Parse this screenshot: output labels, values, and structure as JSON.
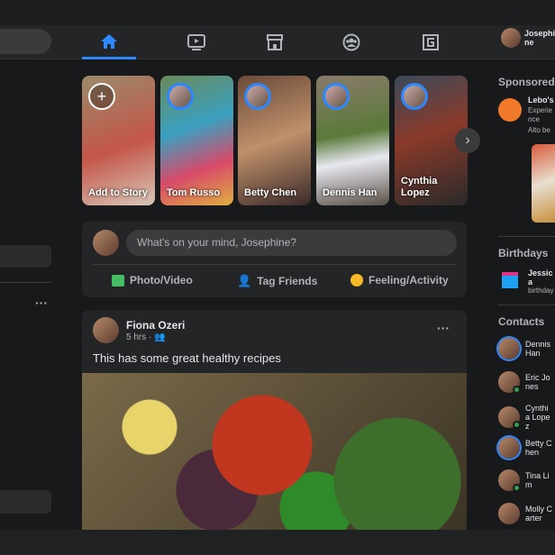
{
  "header": {
    "user_name": "Josephine",
    "nav": [
      {
        "icon": "home-icon",
        "active": true
      },
      {
        "icon": "watch-icon"
      },
      {
        "icon": "marketplace-icon"
      },
      {
        "icon": "groups-icon"
      },
      {
        "icon": "gaming-icon"
      }
    ]
  },
  "accent": "#2d88ff",
  "stories": [
    {
      "name": "Add to Story",
      "add": true
    },
    {
      "name": "Tom Russo"
    },
    {
      "name": "Betty Chen"
    },
    {
      "name": "Dennis Han"
    },
    {
      "name": "Cynthia Lopez"
    }
  ],
  "composer": {
    "placeholder": "What's on your mind, Josephine?",
    "actions": [
      "Photo/Video",
      "Tag Friends",
      "Feeling/Activity"
    ]
  },
  "post": {
    "author": "Fiona Ozeri",
    "time": "5 hrs ·",
    "text": "This has some great healthy recipes"
  },
  "right": {
    "sponsored": "Sponsored",
    "ad_title": "Lebo's",
    "ad_line1": "Experience",
    "ad_line2": "Alto be",
    "birthdays": "Birthdays",
    "birthday_name": "Jessica",
    "birthday_line": "birthday",
    "contacts_title": "Contacts",
    "contacts": [
      {
        "name": "Dennis Han",
        "ring": true
      },
      {
        "name": "Eric Jones",
        "online": true
      },
      {
        "name": "Cynthia Lopez",
        "online": true
      },
      {
        "name": "Betty Chen",
        "ring": true
      },
      {
        "name": "Tina Lim",
        "online": true
      },
      {
        "name": "Molly Carter"
      }
    ]
  }
}
